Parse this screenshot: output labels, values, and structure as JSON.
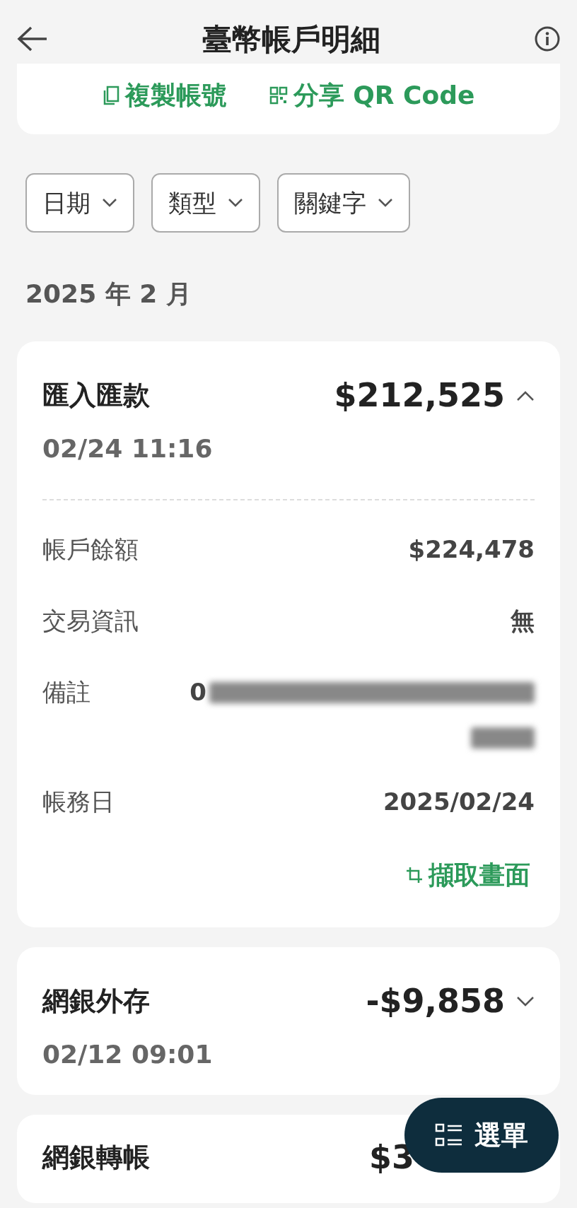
{
  "header": {
    "title": "臺幣帳戶明細"
  },
  "account_actions": [
    {
      "kind": "copy",
      "label": "複製帳號"
    },
    {
      "kind": "qr",
      "label": "分享 QR Code"
    }
  ],
  "filters": [
    {
      "label": "日期"
    },
    {
      "label": "類型"
    },
    {
      "label": "關鍵字"
    }
  ],
  "month": "2025 年 2 月",
  "transactions": [
    {
      "title": "匯入匯款",
      "amount": "$212,525",
      "date": "02/24 11:16",
      "expanded": true,
      "details": [
        {
          "label": "帳戶餘額",
          "value": "$224,478"
        },
        {
          "label": "交易資訊",
          "value": "無"
        },
        {
          "label": "備註",
          "value": "0",
          "redacted": true
        },
        {
          "label": "帳務日",
          "value": "2025/02/24"
        }
      ],
      "action": "擷取畫面"
    },
    {
      "title": "網銀外存",
      "amount": "-$9,858",
      "date": "02/12 09:01",
      "expanded": false
    },
    {
      "title": "網銀轉帳",
      "amount": "$3"
    }
  ],
  "fab": {
    "label": "選單"
  }
}
